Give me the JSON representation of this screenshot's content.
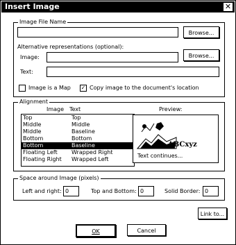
{
  "window": {
    "title": "Insert Image",
    "close_glyph": "✕"
  },
  "file_group": {
    "label": "Image File Name",
    "file_value": "",
    "browse_label": "Browse...",
    "alt_label": "Alternative representations (optional):",
    "image_label": "Image:",
    "image_value": "",
    "browse2_label": "Browse...",
    "text_label": "Text:",
    "text_value": "",
    "is_map_label": "Image is a Map",
    "is_map_checked": false,
    "copy_label": "Copy image to the document's location",
    "copy_checked": true
  },
  "alignment": {
    "label": "Alignment",
    "col_image": "Image",
    "col_text": "Text",
    "rows": [
      {
        "image": "Top",
        "text": "Top",
        "selected": false
      },
      {
        "image": "Middle",
        "text": "Middle",
        "selected": false
      },
      {
        "image": "Middle",
        "text": "Baseline",
        "selected": false
      },
      {
        "image": "Bottom",
        "text": "Bottom",
        "selected": false
      },
      {
        "image": "Bottom",
        "text": "Baseline",
        "selected": true
      },
      {
        "image": "Floating Left",
        "text": "Wrapped Right",
        "selected": false
      },
      {
        "image": "Floating Right",
        "text": "Wrapped Left",
        "selected": false
      }
    ],
    "preview_label": "Preview:",
    "preview_abc": "ABCxyz",
    "preview_text": "Text continues..."
  },
  "space": {
    "label": "Space around Image (pixels)",
    "left_right_label": "Left and right:",
    "left_right_value": "0",
    "top_bottom_label": "Top and Bottom:",
    "top_bottom_value": "0",
    "border_label": "Solid Border:",
    "border_value": "0"
  },
  "buttons": {
    "link_label": "Link to...",
    "ok_label": "OK",
    "cancel_label": "Cancel"
  }
}
